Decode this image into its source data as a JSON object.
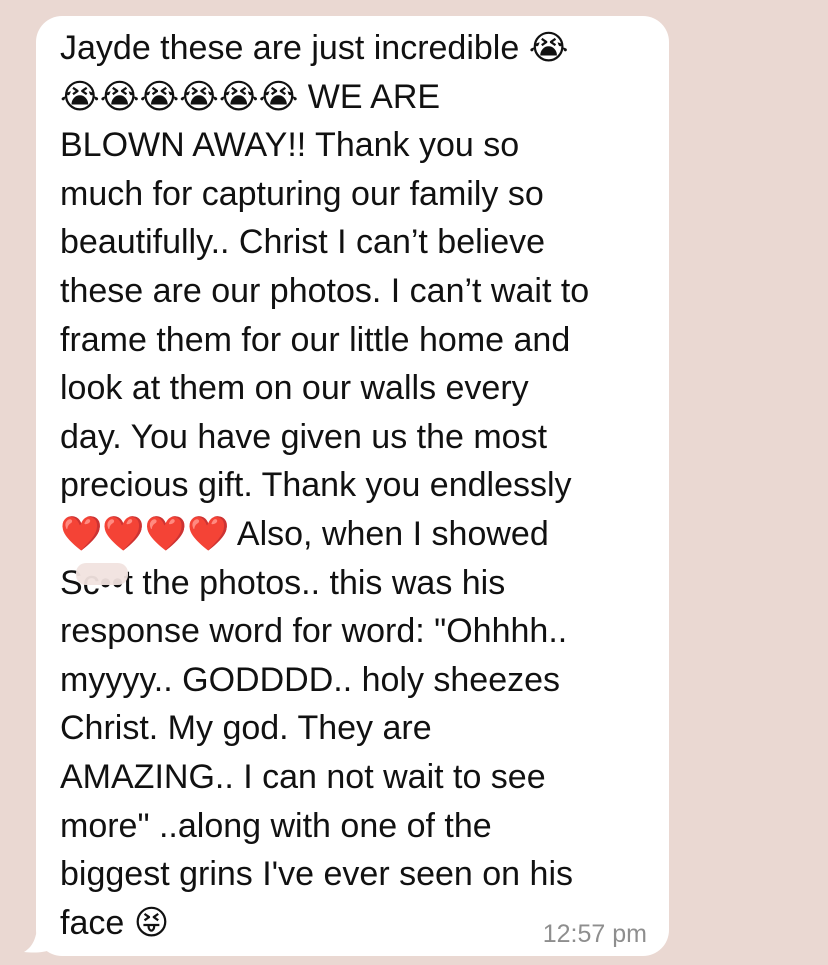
{
  "message": {
    "text": "Jayde these are just incredible 😭\n😭😭😭😭😭😭 WE ARE\nBLOWN AWAY!! Thank you so\nmuch for capturing our family so\nbeautifully.. Christ I can’t believe\nthese are our photos. I can’t wait to\nframe them for our little home and\nlook at them on our walls every\nday. You have given us the most\nprecious gift. Thank you endlessly\n❤️❤️❤️❤️ Also, when I showed\nSc••t the photos.. this was his\nresponse word for word: \"Ohhhh..\nmyyyy.. GODDDD.. holy sheezes\nChrist. My god. They are\nAMAZING.. I can not wait to see\nmore\" ..along with one of the\nbiggest grins I've ever seen on his\nface 😝",
    "timestamp": "12:57 pm"
  },
  "colors": {
    "background": "#ead8d2",
    "bubble": "#ffffff",
    "text": "#111111",
    "timestamp": "#8e8e8e"
  }
}
